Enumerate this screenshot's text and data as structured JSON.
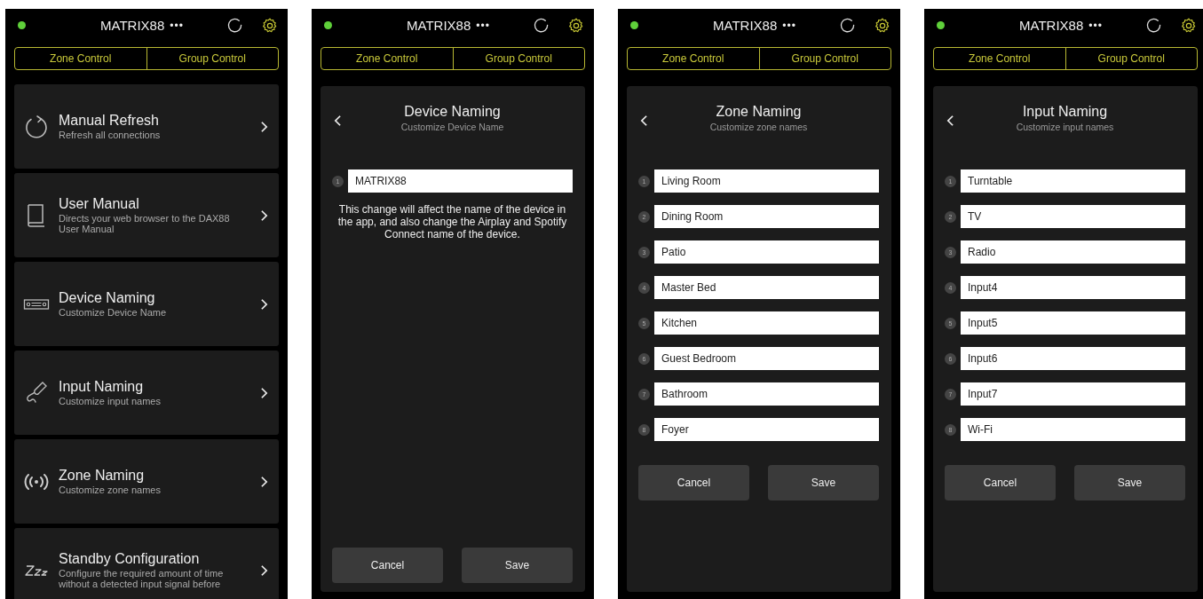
{
  "screens": [
    {
      "kind": "menu",
      "header": {
        "title": "MATRIX88",
        "more": "•••"
      },
      "tabs": [
        {
          "label": "Zone Control"
        },
        {
          "label": "Group Control"
        }
      ],
      "items": [
        {
          "kind": "refresh",
          "title": "Manual Refresh",
          "subtitle": "Refresh all connections"
        },
        {
          "kind": "book",
          "title": "User Manual",
          "subtitle": "Directs your web browser to the DAX88 User Manual"
        },
        {
          "kind": "device",
          "title": "Device Naming",
          "subtitle": "Customize Device Name"
        },
        {
          "kind": "cable",
          "title": "Input Naming",
          "subtitle": "Customize input names"
        },
        {
          "kind": "wireless",
          "title": "Zone Naming",
          "subtitle": "Customize zone names"
        },
        {
          "kind": "sleep",
          "title": "Standby Configuration",
          "subtitle": "Configure the required amount of time without a detected input signal before"
        }
      ]
    },
    {
      "kind": "naming",
      "header": {
        "title": "MATRIX88",
        "more": "•••"
      },
      "tabs": [
        {
          "label": "Zone Control"
        },
        {
          "label": "Group Control"
        }
      ],
      "panel": {
        "title": "Device Naming",
        "subtitle": "Customize Device Name",
        "fields": [
          {
            "number": "1",
            "value": "MATRIX88"
          }
        ],
        "description": "This change will affect the name of the device in the app, and also change the Airplay and Spotify Connect name of the device.",
        "buttons": [
          "Cancel",
          "Save"
        ]
      }
    },
    {
      "kind": "naming",
      "header": {
        "title": "MATRIX88",
        "more": "•••"
      },
      "tabs": [
        {
          "label": "Zone Control"
        },
        {
          "label": "Group Control"
        }
      ],
      "panel": {
        "title": "Zone Naming",
        "subtitle": "Customize zone names",
        "fields": [
          {
            "number": "1",
            "value": "Living Room"
          },
          {
            "number": "2",
            "value": "Dining Room"
          },
          {
            "number": "3",
            "value": "Patio"
          },
          {
            "number": "4",
            "value": "Master Bed"
          },
          {
            "number": "5",
            "value": "Kitchen"
          },
          {
            "number": "6",
            "value": "Guest Bedroom"
          },
          {
            "number": "7",
            "value": "Bathroom"
          },
          {
            "number": "8",
            "value": "Foyer"
          }
        ],
        "buttons": [
          "Cancel",
          "Save"
        ]
      }
    },
    {
      "kind": "naming",
      "header": {
        "title": "MATRIX88",
        "more": "•••"
      },
      "tabs": [
        {
          "label": "Zone Control"
        },
        {
          "label": "Group Control"
        }
      ],
      "panel": {
        "title": "Input Naming",
        "subtitle": "Customize input names",
        "fields": [
          {
            "number": "1",
            "value": "Turntable"
          },
          {
            "number": "2",
            "value": "TV"
          },
          {
            "number": "3",
            "value": "Radio"
          },
          {
            "number": "4",
            "value": "Input4"
          },
          {
            "number": "5",
            "value": "Input5"
          },
          {
            "number": "6",
            "value": "Input6"
          },
          {
            "number": "7",
            "value": "Input7"
          },
          {
            "number": "8",
            "value": "Wi-Fi"
          }
        ],
        "buttons": [
          "Cancel",
          "Save"
        ]
      }
    }
  ]
}
